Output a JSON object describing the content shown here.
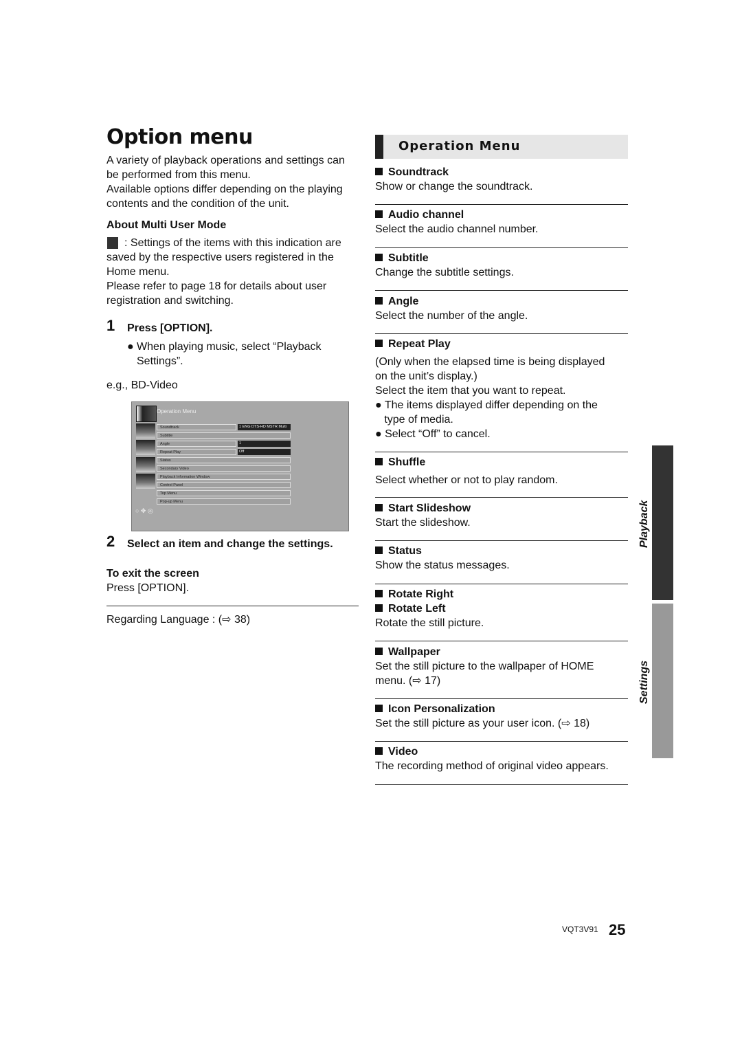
{
  "title": "Option menu",
  "intro": [
    "A variety of playback operations and settings can",
    "be performed from this menu.",
    "Available options differ depending on the playing",
    "contents and the condition of the unit."
  ],
  "multi_user": {
    "heading": "About Multi User Mode",
    "lines": [
      ": Settings of the items with this indication are",
      "saved by the respective users registered in the",
      "Home menu.",
      "Please refer to page 18 for details about user",
      "registration and switching."
    ]
  },
  "step1": {
    "num": "1",
    "label": "Press [OPTION].",
    "bullet": [
      "When playing music, select “Playback",
      "Settings”."
    ],
    "eg": "e.g., BD-Video"
  },
  "screen": {
    "title": "Operation Menu",
    "rows": [
      "Soundtrack",
      "Subtitle",
      "Angle",
      "Repeat Play",
      "Status",
      "Secondary Video",
      "Playback Information Window",
      "Control Panel",
      "Top Menu",
      "Pop-up Menu"
    ],
    "values": {
      "soundtrack": "1 ENG DTS-HD MSTR Multi",
      "angle": "1",
      "repeat": "Off"
    }
  },
  "step2": {
    "num": "2",
    "label": "Select an item and change the settings."
  },
  "exit": {
    "heading": "To exit the screen",
    "text": "Press [OPTION]."
  },
  "language": "Regarding Language : (⇨ 38)",
  "op_menu": {
    "title": "Operation Menu",
    "items": [
      {
        "h": "Soundtrack",
        "t": [
          "Show or change the soundtrack."
        ]
      },
      {
        "h": "Audio channel",
        "t": [
          "Select the audio channel number."
        ]
      },
      {
        "h": "Subtitle",
        "t": [
          "Change the subtitle settings."
        ]
      },
      {
        "h": "Angle",
        "t": [
          "Select the number of the angle."
        ]
      },
      {
        "h": "Repeat Play",
        "t": [
          "(Only when the elapsed time is being displayed",
          "on the unit’s display.)",
          "Select the item that you want to repeat.",
          "● The items displayed differ depending on the",
          "   type of media.",
          "● Select “Off” to cancel."
        ]
      },
      {
        "h": "Shuffle",
        "t": [
          "Select whether or not to play random."
        ]
      },
      {
        "h": "Start Slideshow",
        "t": [
          "Start the slideshow."
        ]
      },
      {
        "h": "Status",
        "t": [
          "Show the status messages."
        ]
      },
      {
        "h": "Rotate Right",
        "h2": "Rotate Left",
        "t": [
          "Rotate the still picture."
        ]
      },
      {
        "h": "Wallpaper",
        "t": [
          "Set the still picture to the wallpaper of HOME",
          "menu. (⇨ 17)"
        ]
      },
      {
        "h": "Icon Personalization",
        "t": [
          "Set the still picture as your user icon. (⇨ 18)"
        ]
      },
      {
        "h": "Video",
        "t": [
          "The recording method of original video appears."
        ]
      }
    ]
  },
  "tabs": {
    "playback": "Playback",
    "settings": "Settings",
    "playback_color": "#333333",
    "settings_color": "#999999"
  },
  "footer": {
    "code": "VQT3V91",
    "page": "25"
  }
}
